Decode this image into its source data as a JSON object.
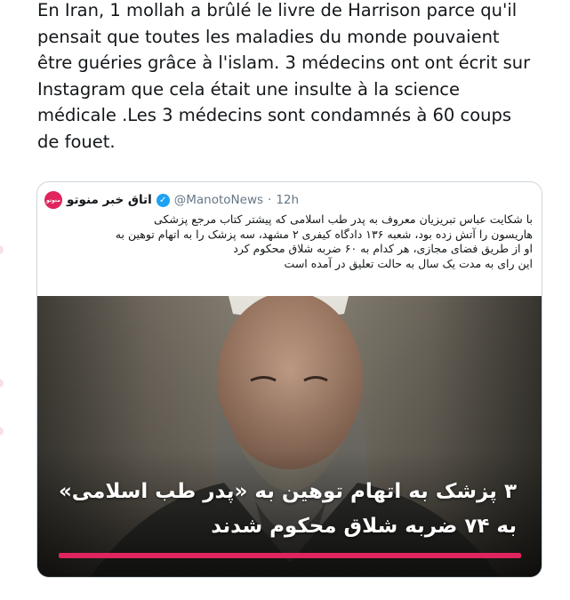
{
  "tweet": {
    "text": "En Iran, 1 mollah a brûlé le livre de Harrison parce qu'il\npensait que toutes les maladies du monde pouvaient\nêtre guéries grâce à l'islam. 3 médecins ont ont écrit sur\nInstagram que cela était une insulte à la science\nmédicale .Les 3 médecins sont condamnés à 60 coups\nde fouet."
  },
  "quoted": {
    "avatar_text": "منوتو",
    "display_name": "اتاق خبر منوتو",
    "verified_icon": "✓",
    "handle": "@ManotoNews",
    "separator": "·",
    "time": "12h",
    "body_lines": [
      "با شکایت عباس تبریزیان معروف به پدر طب اسلامی که پیشتر کتاب مرجع پزشکی",
      "هاریسون را آتش زده بود، شعبه ۱۳۶ دادگاه کیفری ۲ مشهد، سه پزشک را به اتهام توهین به",
      "او از طریق فضای مجازی، هر کدام به ۶۰ ضربه شلاق محکوم کرد",
      "این رای به مدت یک سال به حالت تعلیق در آمده است"
    ],
    "image_caption": [
      "۳ پزشک به اتهام توهین به «پدر طب اسلامی»",
      "به ۷۴ ضربه شلاق محکوم شدند"
    ]
  }
}
